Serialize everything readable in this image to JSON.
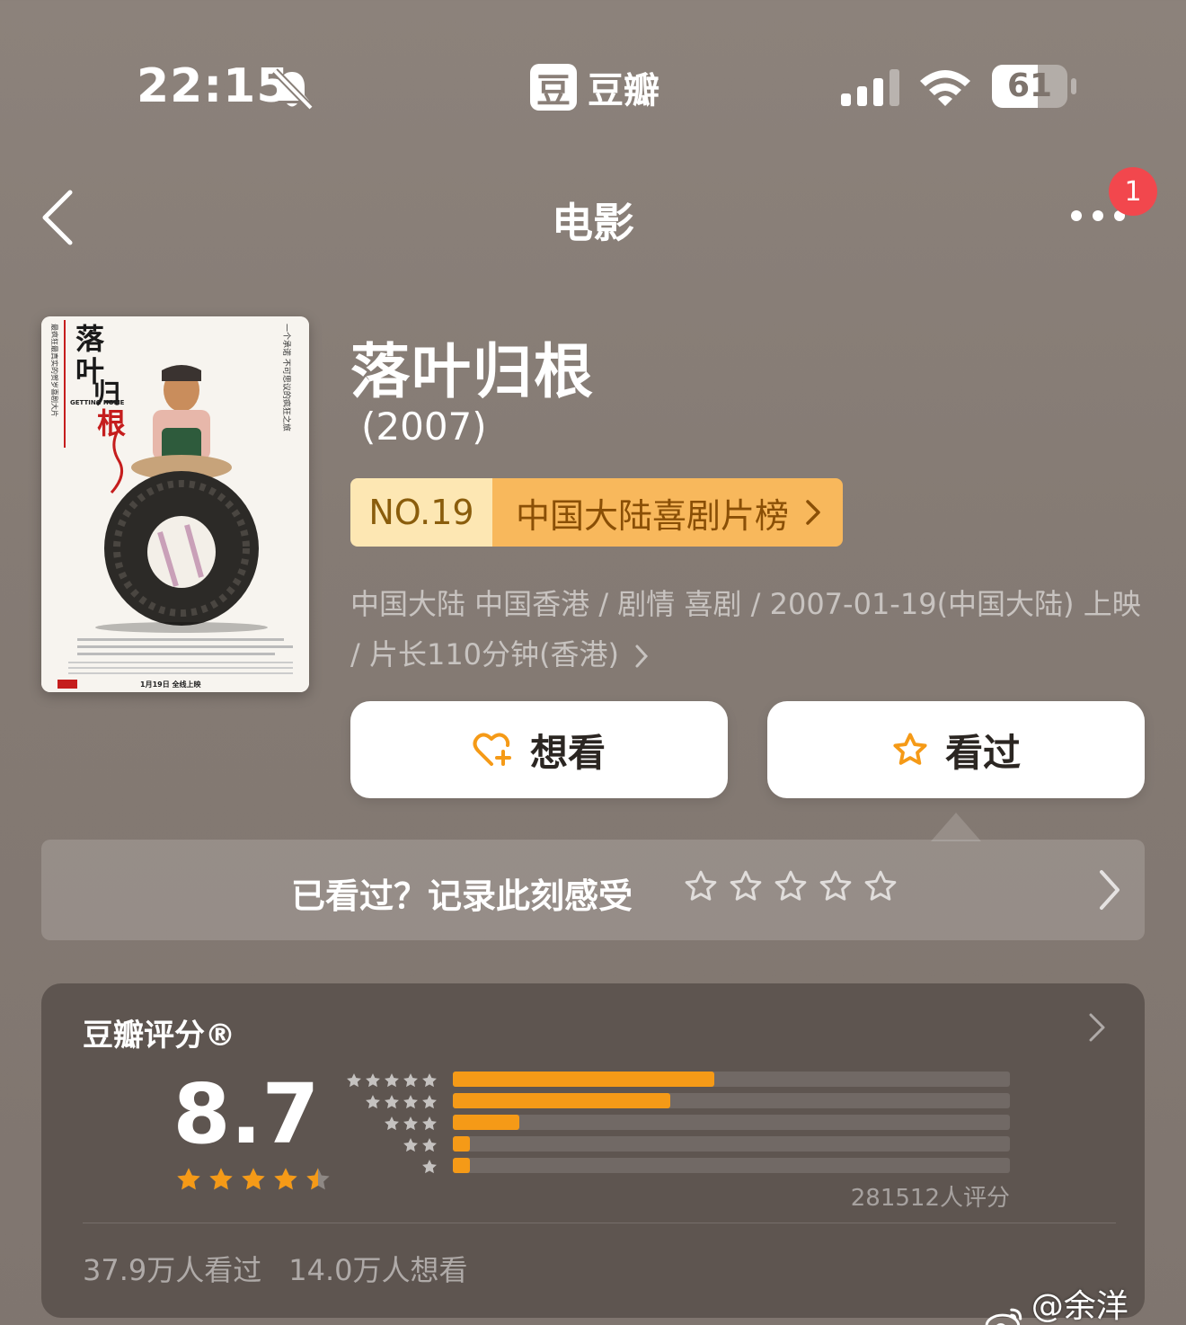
{
  "status_bar": {
    "time": "22:15",
    "app_name": "豆瓣",
    "app_logo_glyph": "豆",
    "battery_level": "61",
    "battery_fraction": 0.61
  },
  "nav": {
    "title": "电影",
    "notification_count": "1"
  },
  "poster": {
    "title_chars": [
      "落",
      "叶",
      "归",
      "根"
    ],
    "english_title": "GETTING HOME",
    "release_line": "1月19日 全线上映",
    "left_slogan": "最疯狂最真实的贺岁喜剧大片",
    "right_slogan": "一个承诺 不可思议的疯狂之旅"
  },
  "movie": {
    "title": "落叶归根",
    "year": "(2007)",
    "rank_no": "NO.19",
    "rank_list": "中国大陆喜剧片榜",
    "info": "中国大陆 中国香港 / 剧情 喜剧 / 2007-01-19(中国大陆) 上映 / 片长110分钟(香港)"
  },
  "actions": {
    "want_label": "想看",
    "watched_label": "看过"
  },
  "record": {
    "prompt": "已看过？记录此刻感受"
  },
  "rating": {
    "label": "豆瓣评分®",
    "score": "8.7",
    "score_stars": 4.5,
    "distribution": [
      0.47,
      0.39,
      0.12,
      0.03,
      0.03
    ],
    "count": "281512人评分",
    "watched": "37.9万人看过",
    "wanted": "14.0万人想看"
  },
  "watermark": {
    "text": "@余洋ddc"
  },
  "colors": {
    "accent_orange": "#f59a17",
    "rank_light": "#fde7b3",
    "rank_dark": "#f8b85c",
    "badge_red": "#f2474d"
  }
}
